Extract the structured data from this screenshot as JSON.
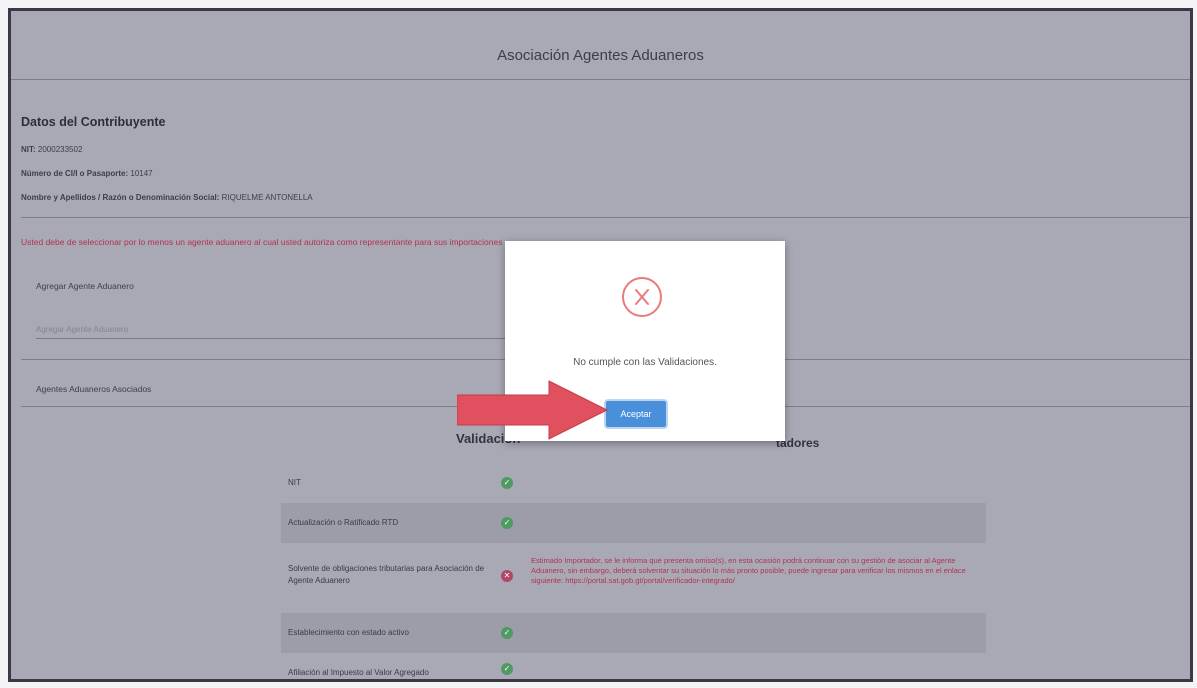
{
  "app": {
    "title": "Asociación Agentes Aduaneros"
  },
  "contributor": {
    "section_title": "Datos del Contribuyente",
    "nit_label": "NIT:",
    "nit_value": "2000233502",
    "ci_label": "Número de CI/I o Pasaporte:",
    "ci_value": "10147",
    "name_label": "Nombre y Apellidos / Razón o Denominación Social:",
    "name_value": "RIQUELME ANTONELLA"
  },
  "warning": "Usted debe de seleccionar por lo menos un agente aduanero al cual usted autoriza como representante para sus importaciones",
  "add_agent": {
    "label": "Agregar Agente Aduanero",
    "placeholder": "Agregar Agente Aduanero"
  },
  "associated_label": "Agentes Aduaneros Asociados",
  "validation": {
    "title": "Validación",
    "title_tail": "tadores",
    "rows": [
      {
        "label": "NIT",
        "status": "ok",
        "message": ""
      },
      {
        "label": "Actualización o Ratificado RTD",
        "status": "ok",
        "message": ""
      },
      {
        "label": "Solvente de obligaciones tributarias para Asociación de Agente Aduanero",
        "status": "error",
        "message": "Estimado Importador, se le informa que presenta omiso(s), en esta ocasión podrá continuar con su gestión de asociar al Agente Aduanero, sin embargo, deberá solventar su situación lo más pronto posible, puede ingresar para verificar los mismos en el enlace siguiente: https://portal.sat.gob.gt/portal/verificador-integrado/"
      },
      {
        "label": "Establecimiento con estado activo",
        "status": "ok",
        "message": ""
      },
      {
        "label": "Afiliación al Impuesto al Valor Agregado",
        "status": "ok",
        "message": ""
      }
    ]
  },
  "modal": {
    "message": "No cumple con las Validaciones.",
    "accept_label": "Aceptar"
  },
  "colors": {
    "overlay": "#a9a9b6",
    "accent": "#4a8fd9",
    "error": "#b3324f",
    "ok": "#4e9a62",
    "arrow": "#e0505f"
  }
}
